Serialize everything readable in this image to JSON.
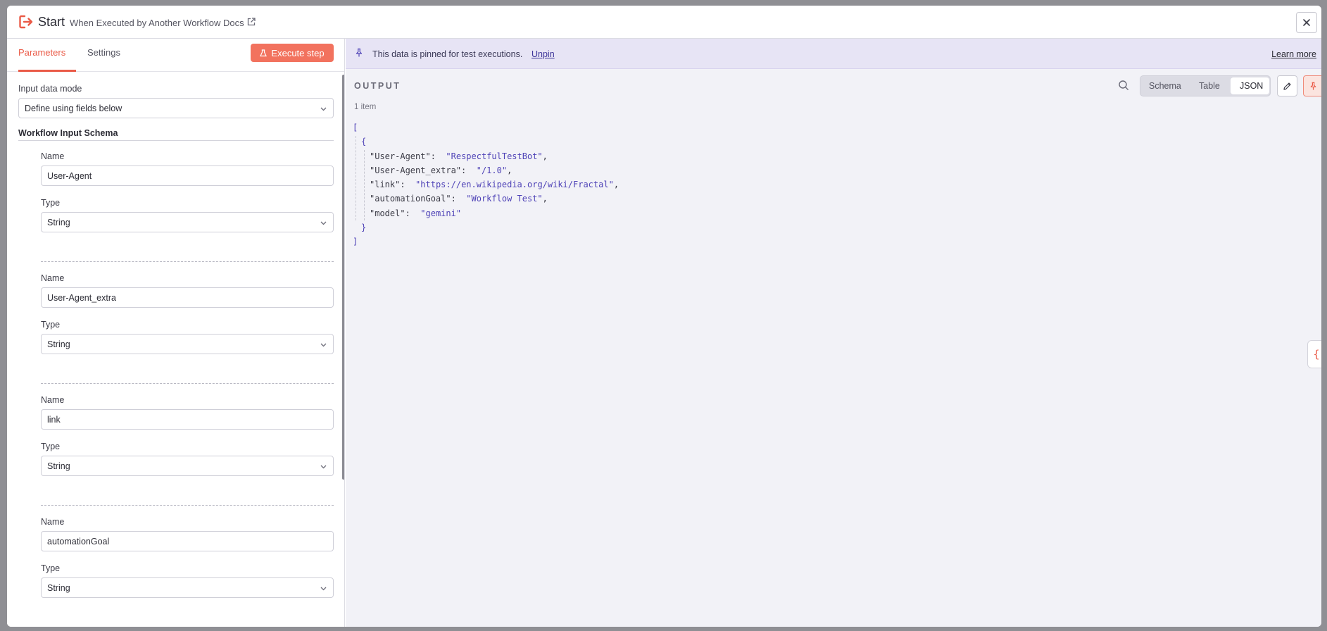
{
  "header": {
    "title": "Start",
    "subtitle": "When Executed by Another Workflow Docs"
  },
  "left": {
    "tabs": [
      {
        "label": "Parameters",
        "active": true
      },
      {
        "label": "Settings",
        "active": false
      }
    ],
    "execute_label": "Execute step",
    "input_mode_label": "Input data mode",
    "input_mode_value": "Define using fields below",
    "schema_title": "Workflow Input Schema",
    "name_label": "Name",
    "type_label": "Type",
    "fields": [
      {
        "name": "User-Agent",
        "type": "String"
      },
      {
        "name": "User-Agent_extra",
        "type": "String"
      },
      {
        "name": "link",
        "type": "String"
      },
      {
        "name": "automationGoal",
        "type": "String"
      }
    ]
  },
  "right": {
    "banner_text": "This data is pinned for test executions.",
    "unpin_label": "Unpin",
    "learn_more_label": "Learn more",
    "output_title": "OUTPUT",
    "items_count": "1 item",
    "view_modes": [
      "Schema",
      "Table",
      "JSON"
    ],
    "active_view": "JSON",
    "json_lines": [
      {
        "key": "\"User-Agent\"",
        "value": "\"RespectfulTestBot\"",
        "comma": ","
      },
      {
        "key": "\"User-Agent_extra\"",
        "value": "\"/1.0\"",
        "comma": ","
      },
      {
        "key": "\"link\"",
        "value": "\"https://en.wikipedia.org/wiki/Fractal\"",
        "comma": ","
      },
      {
        "key": "\"automationGoal\"",
        "value": "\"Workflow Test\"",
        "comma": ","
      },
      {
        "key": "\"model\"",
        "value": "\"gemini\"",
        "comma": ""
      }
    ],
    "brackets": {
      "open_array": "[",
      "open_obj": "{",
      "close_obj": "}",
      "close_array": "]"
    },
    "side_tab_glyph": "{"
  },
  "colors": {
    "accent": "#ea5b48",
    "execute_bg": "#f2725e",
    "banner_bg": "#e7e4f5",
    "json_value": "#4f43b7"
  },
  "icons": {
    "node": "sign-out-icon",
    "external": "external-link-icon",
    "close": "close-icon",
    "flask": "flask-icon",
    "chevron": "chevron-down-icon",
    "pin": "pin-icon",
    "search": "search-icon",
    "edit": "pencil-icon"
  }
}
